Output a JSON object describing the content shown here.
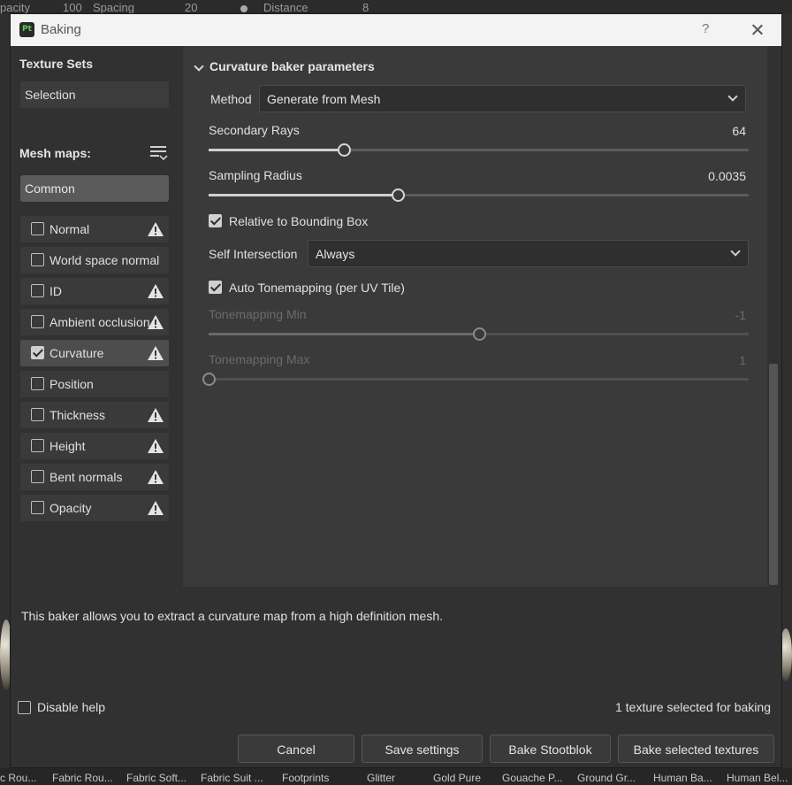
{
  "background": {
    "top_labels": [
      "pacity",
      "100",
      "Spacing",
      "20",
      "Distance",
      "8"
    ],
    "bottom_labels": [
      "c Rou...",
      "Fabric Rou...",
      "Fabric Soft...",
      "Fabric Suit ...",
      "Footprints",
      "Glitter",
      "Gold Pure",
      "Gouache P...",
      "Ground Gr...",
      "Human Ba...",
      "Human Bel..."
    ]
  },
  "window": {
    "title": "Baking",
    "app_icon": "Pt",
    "help": "?"
  },
  "left": {
    "texture_sets_title": "Texture Sets",
    "selection_label": "Selection",
    "mesh_maps_title": "Mesh maps:",
    "common_label": "Common",
    "maps": [
      {
        "label": "Normal",
        "checked": false,
        "warning": true
      },
      {
        "label": "World space normal",
        "checked": false,
        "warning": false
      },
      {
        "label": "ID",
        "checked": false,
        "warning": true
      },
      {
        "label": "Ambient occlusion",
        "checked": false,
        "warning": true
      },
      {
        "label": "Curvature",
        "checked": true,
        "warning": true
      },
      {
        "label": "Position",
        "checked": false,
        "warning": false
      },
      {
        "label": "Thickness",
        "checked": false,
        "warning": true
      },
      {
        "label": "Height",
        "checked": false,
        "warning": true
      },
      {
        "label": "Bent normals",
        "checked": false,
        "warning": true
      },
      {
        "label": "Opacity",
        "checked": false,
        "warning": true
      }
    ]
  },
  "params": {
    "section_title": "Curvature baker parameters",
    "method_label": "Method",
    "method_value": "Generate from Mesh",
    "secondary_rays_label": "Secondary Rays",
    "secondary_rays_value": "64",
    "secondary_rays_fraction": 0.25,
    "sampling_radius_label": "Sampling Radius",
    "sampling_radius_value": "0.0035",
    "sampling_radius_fraction": 0.35,
    "relative_bbox_label": "Relative to Bounding Box",
    "relative_bbox_checked": true,
    "self_intersection_label": "Self Intersection",
    "self_intersection_value": "Always",
    "auto_tonemapping_label": "Auto Tonemapping (per UV Tile)",
    "auto_tonemapping_checked": true,
    "tonemapping_min_label": "Tonemapping Min",
    "tonemapping_min_value": "-1",
    "tonemapping_min_fraction": 0.5,
    "tonemapping_max_label": "Tonemapping Max",
    "tonemapping_max_value": "1",
    "tonemapping_max_fraction": 0.0
  },
  "footer": {
    "help_text": "This baker allows you to extract a curvature map from a high definition mesh.",
    "disable_help_label": "Disable help",
    "disable_help_checked": false,
    "bake_count": "1 texture selected for baking",
    "cancel_label": "Cancel",
    "save_label": "Save settings",
    "bake_one_label": "Bake Stootblok",
    "bake_selected_label": "Bake selected textures"
  }
}
